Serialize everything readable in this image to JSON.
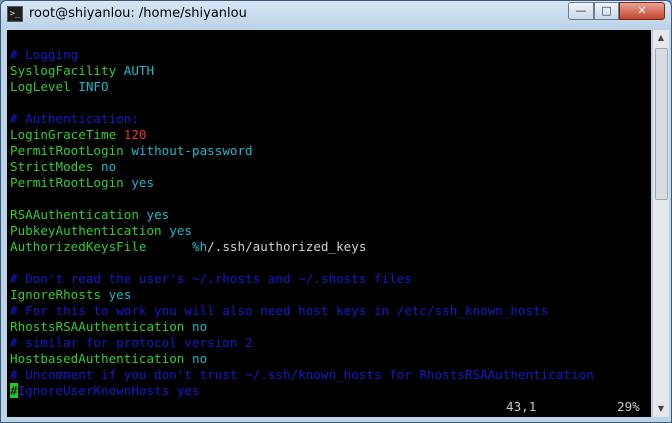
{
  "window": {
    "title": "root@shiyanlou: /home/shiyanlou",
    "buttons": {
      "minimize": "—",
      "maximize": "□",
      "close": "✕"
    }
  },
  "terminal": {
    "lines": [
      {
        "key": "# Logging",
        "val": "",
        "keyColor": "blue"
      },
      {
        "key": "SyslogFacility",
        "val": "AUTH",
        "keyColor": "green",
        "valColor": "cyan"
      },
      {
        "key": "LogLevel",
        "val": "INFO",
        "keyColor": "green",
        "valColor": "cyan"
      },
      {
        "key": "",
        "val": ""
      },
      {
        "key": "# Authentication:",
        "val": "",
        "keyColor": "blue"
      },
      {
        "key": "LoginGraceTime",
        "val": "120",
        "keyColor": "green",
        "valColor": "red"
      },
      {
        "key": "PermitRootLogin",
        "val": "without-password",
        "keyColor": "green",
        "valColor": "cyan"
      },
      {
        "key": "StrictModes",
        "val": "no",
        "keyColor": "green",
        "valColor": "cyan"
      },
      {
        "key": "PermitRootLogin",
        "val": "yes",
        "keyColor": "green",
        "valColor": "cyan"
      },
      {
        "key": "",
        "val": ""
      },
      {
        "key": "RSAAuthentication",
        "val": "yes",
        "keyColor": "green",
        "valColor": "cyan"
      },
      {
        "key": "PubkeyAuthentication",
        "val": "yes",
        "keyColor": "green",
        "valColor": "cyan"
      },
      {
        "key": "AuthorizedKeysFile",
        "val": "     %h/.ssh/authorized_keys",
        "keyColor": "green",
        "valColor": "mixed"
      },
      {
        "key": "",
        "val": ""
      },
      {
        "key": "# Don't read the user's ~/.rhosts and ~/.shosts files",
        "val": "",
        "keyColor": "blue"
      },
      {
        "key": "IgnoreRhosts",
        "val": "yes",
        "keyColor": "green",
        "valColor": "cyan"
      },
      {
        "key": "# For this to work you will also need host keys in /etc/ssh_known_hosts",
        "val": "",
        "keyColor": "blue"
      },
      {
        "key": "RhostsRSAAuthentication",
        "val": "no",
        "keyColor": "green",
        "valColor": "cyan"
      },
      {
        "key": "# similar for protocol version 2",
        "val": "",
        "keyColor": "blue"
      },
      {
        "key": "HostbasedAuthentication",
        "val": "no",
        "keyColor": "green",
        "valColor": "cyan"
      },
      {
        "key": "# Uncomment if you don't trust ~/.ssh/known_hosts for RhostsRSAAuthentication",
        "val": "",
        "keyColor": "blue"
      },
      {
        "key": "#IgnoreUserKnownHosts yes",
        "val": "",
        "keyColor": "blue"
      }
    ],
    "status_position": "43,1",
    "status_percent": "29%"
  },
  "colors": {
    "comment": "#1818c8",
    "keyword": "#33cc33",
    "value": "#20b7c7",
    "number": "#e03535",
    "cursor": "#20d020"
  }
}
